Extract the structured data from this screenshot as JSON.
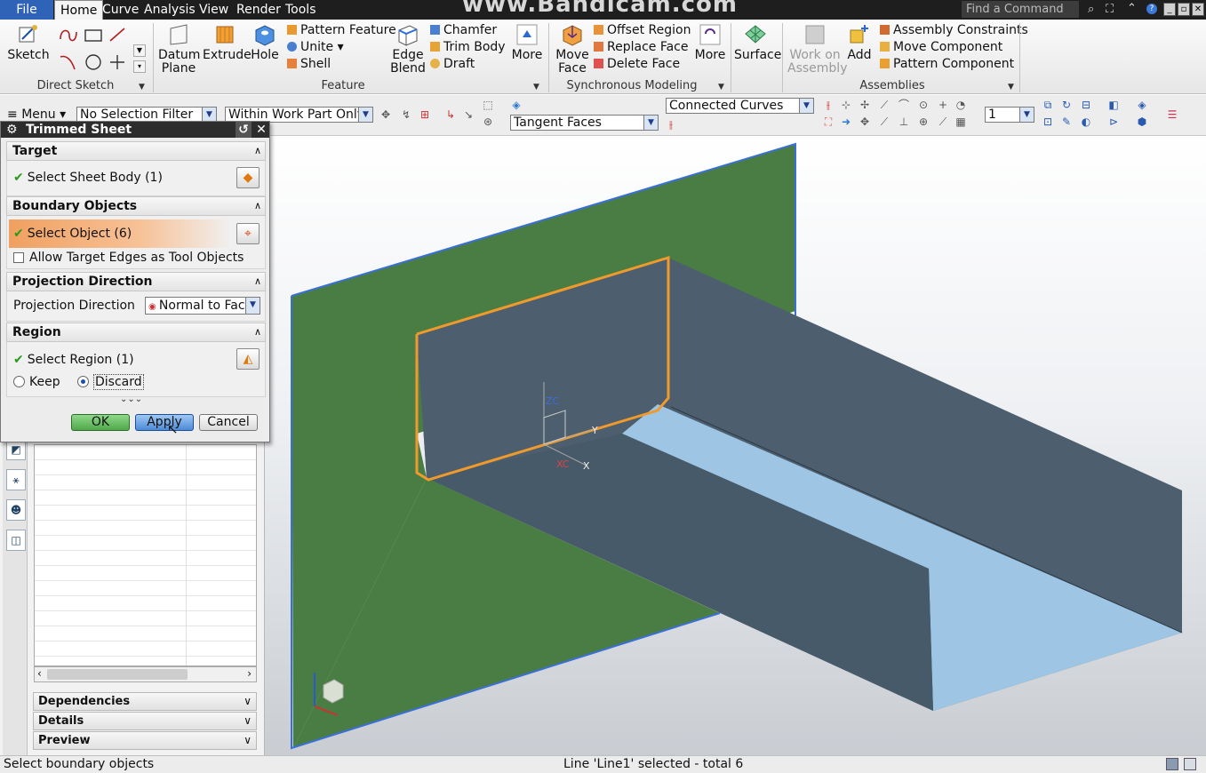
{
  "menubar": {
    "tabs": [
      "File",
      "Home",
      "Curve",
      "Analysis",
      "View",
      "Render",
      "Tools"
    ],
    "watermark": "www.Bandicam.com",
    "find_command_placeholder": "Find a Command"
  },
  "ribbon": {
    "direct_sketch": {
      "sketch": "Sketch",
      "label": "Direct Sketch"
    },
    "feature": {
      "datum_plane": "Datum Plane",
      "extrude": "Extrude",
      "hole": "Hole",
      "pattern_feature": "Pattern Feature",
      "unite": "Unite",
      "shell": "Shell",
      "edge_blend": "Edge Blend",
      "chamfer": "Chamfer",
      "trim_body": "Trim Body",
      "draft": "Draft",
      "more": "More",
      "label": "Feature"
    },
    "synchronous": {
      "move_face": "Move Face",
      "offset_region": "Offset Region",
      "replace_face": "Replace Face",
      "delete_face": "Delete Face",
      "more": "More",
      "label": "Synchronous Modeling"
    },
    "surface": "Surface",
    "assemblies": {
      "work_on_assembly": "Work on Assembly",
      "add": "Add",
      "assembly_constraints": "Assembly Constraints",
      "move_component": "Move Component",
      "pattern_component": "Pattern Component",
      "label": "Assemblies"
    }
  },
  "toolbar": {
    "menu": "Menu",
    "selection_filter": "No Selection Filter",
    "scope": "Within Work Part Only",
    "face_rule": "Tangent Faces",
    "curve_rule": "Connected Curves",
    "layer": "1"
  },
  "dialog": {
    "title": "Trimmed Sheet",
    "target": {
      "header": "Target",
      "select_sheet": "Select Sheet Body (1)"
    },
    "boundary": {
      "header": "Boundary Objects",
      "select_object": "Select Object (6)",
      "allow_edges": "Allow Target Edges as Tool Objects",
      "allow_edges_checked": false
    },
    "projection": {
      "header": "Projection Direction",
      "label": "Projection Direction",
      "value": "Normal to Fac"
    },
    "region": {
      "header": "Region",
      "select_region": "Select Region (1)",
      "keep": "Keep",
      "discard": "Discard",
      "selected": "Discard"
    },
    "buttons": {
      "ok": "OK",
      "apply": "Apply",
      "cancel": "Cancel"
    }
  },
  "navigator": {
    "panels": [
      "Dependencies",
      "Details",
      "Preview"
    ]
  },
  "viewport": {
    "csys_labels": {
      "zc": "ZC",
      "yc": "Y",
      "xc": "X",
      "xc2": "XC"
    }
  },
  "status": {
    "prompt": "Select boundary objects",
    "message": "Line 'Line1' selected - total 6"
  },
  "colors": {
    "sheet_green": "#4a7d43",
    "sheet_edge": "#3a6fd8",
    "body_dark": "#4d5f6e",
    "body_light": "#9ec6e4",
    "selection_orange": "#f09a2c",
    "file_tab": "#2f63b8"
  }
}
